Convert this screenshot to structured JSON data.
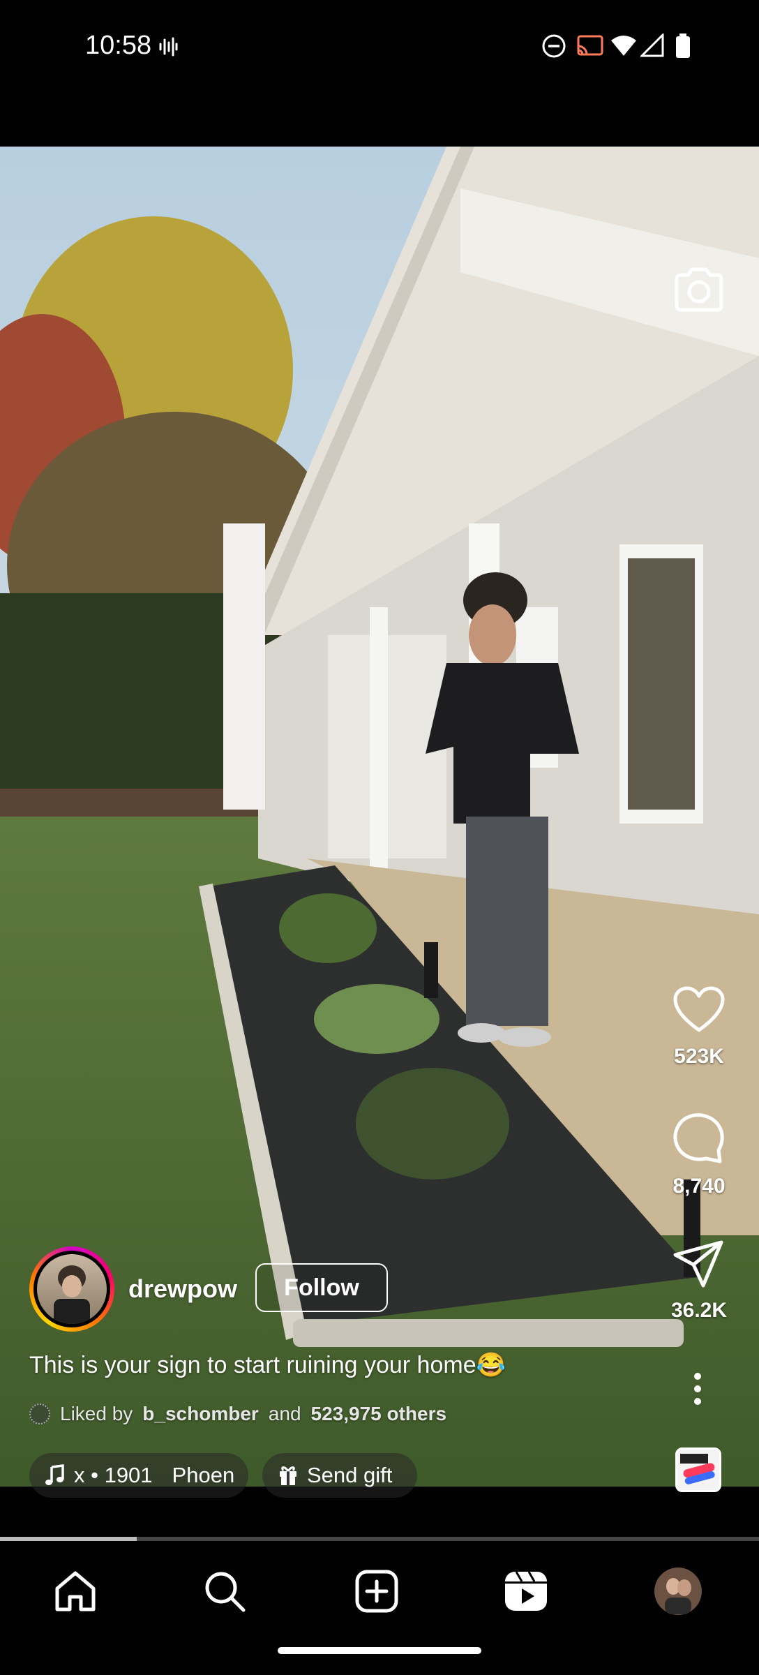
{
  "status_bar": {
    "time": "10:58"
  },
  "post": {
    "username": "drewpow",
    "follow_label": "Follow",
    "caption": "This is your sign to start ruining your home😂",
    "liked": {
      "prefix": "Liked by",
      "user": "b_schomber",
      "middle": "and",
      "others": "523,975 others"
    },
    "music_text": "x • 1901",
    "music_artist": "Phoen",
    "gift_label": "Send gift",
    "progress": 0.18
  },
  "actions": {
    "likes": "523K",
    "comments": "8,740",
    "shares": "36.2K"
  },
  "nav": {
    "items": [
      "home-icon",
      "search-icon",
      "create-icon",
      "reels-icon",
      "profile-avatar"
    ]
  },
  "colors": {
    "background": "#000000",
    "text": "#ffffff"
  }
}
